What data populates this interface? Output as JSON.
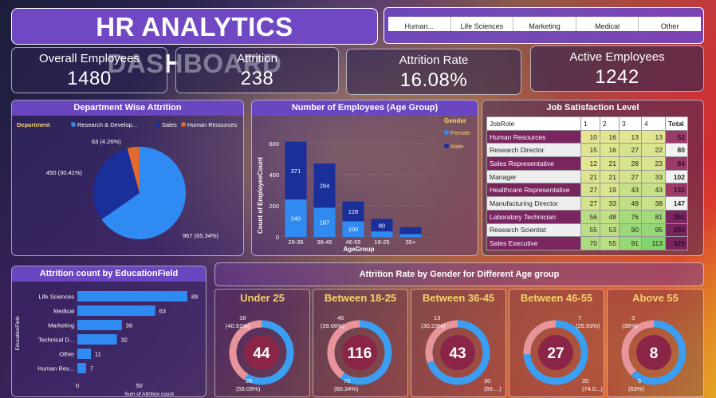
{
  "dashboard": {
    "title": "HR ANALYTICS DASHBOARD"
  },
  "slicer": {
    "items": [
      "Human...",
      "Life Sciences",
      "Marketing",
      "Medical",
      "Other"
    ]
  },
  "kpis": [
    {
      "label": "Overall Employees",
      "value": "1480"
    },
    {
      "label": "Attrition",
      "value": "238"
    },
    {
      "label": "Attrition Rate",
      "value": "16.08%"
    },
    {
      "label": "Active Employees",
      "value": "1242"
    }
  ],
  "colors": {
    "research": "#2f8bf2",
    "sales": "#1a2f9a",
    "hr": "#e36a2f",
    "female": "#2f8bf2",
    "male": "#1a2f9a",
    "donut_a": "#e8949a",
    "donut_b": "#3a9ef2",
    "accent": "#6a46c0"
  },
  "chart_data": [
    {
      "type": "pie",
      "title": "Department Wise Attrition",
      "legend_title": "Department",
      "legend": [
        "Research & Develop...",
        "Sales",
        "Human Resources"
      ],
      "values": [
        967,
        450,
        63
      ],
      "labels": [
        "967 (65.34%)",
        "450 (30.41%)",
        "63 (4.26%)"
      ]
    },
    {
      "type": "bar",
      "title": "Number of Employees (Age Group)",
      "xlabel": "AgeGroup",
      "ylabel": "Count of EmployeeCount",
      "legend_title": "Gender",
      "categories": [
        "26-35",
        "36-45",
        "46-55",
        "18-25",
        "55+"
      ],
      "series": [
        {
          "name": "Female",
          "values": [
            240,
            187,
            100,
            35,
            18
          ]
        },
        {
          "name": "Male",
          "values": [
            371,
            284,
            128,
            80,
            44
          ]
        }
      ],
      "bar_labels": {
        "Female": [
          "240",
          "187",
          "100",
          "",
          ""
        ],
        "Male": [
          "371",
          "284",
          "128",
          "80",
          ""
        ]
      },
      "yticks": [
        "0",
        "200",
        "400",
        "600"
      ],
      "ylim": [
        0,
        650
      ]
    },
    {
      "type": "table",
      "title": "Job Satisfaction Level",
      "columns": [
        "JobRole",
        "1",
        "2",
        "3",
        "4",
        "Total"
      ],
      "rows": [
        [
          "Human Resources",
          "10",
          "16",
          "13",
          "13",
          "52"
        ],
        [
          "Research Director",
          "15",
          "16",
          "27",
          "22",
          "80"
        ],
        [
          "Sales Representative",
          "12",
          "21",
          "28",
          "23",
          "84"
        ],
        [
          "Manager",
          "21",
          "21",
          "27",
          "33",
          "102"
        ],
        [
          "Healthcare Representative",
          "27",
          "19",
          "43",
          "43",
          "132"
        ],
        [
          "Manufacturing Director",
          "27",
          "33",
          "49",
          "38",
          "147"
        ],
        [
          "Laboratory Technician",
          "56",
          "48",
          "76",
          "81",
          "261"
        ],
        [
          "Research Scientist",
          "55",
          "53",
          "90",
          "95",
          "293"
        ],
        [
          "Sales Executive",
          "70",
          "55",
          "91",
          "113",
          "329"
        ]
      ]
    },
    {
      "type": "bar",
      "title": "Attrition count by EducationField",
      "xlabel": "Sum of Attrition count",
      "ylabel": "EducationField",
      "categories": [
        "Life Sciences",
        "Medical",
        "Marketing",
        "Technical D...",
        "Other",
        "Human Res..."
      ],
      "values": [
        89,
        63,
        36,
        32,
        11,
        7
      ],
      "xticks": [
        "0",
        "50"
      ],
      "xlim": [
        0,
        100
      ]
    },
    {
      "type": "pie",
      "title": "Attrition Rate by Gender for Different Age group",
      "groups": [
        {
          "name": "Under 25",
          "total": "44",
          "a": 18,
          "b": 26,
          "a_label": [
            "18",
            "(40.91%)"
          ],
          "b_label": [
            "26",
            "(59.09%)"
          ]
        },
        {
          "name": "Between 18-25",
          "total": "116",
          "a": 46,
          "b": 70,
          "a_label": [
            "46",
            "(39.66%)"
          ],
          "b_label": [
            "70",
            "(60.34%)"
          ]
        },
        {
          "name": "Between 36-45",
          "total": "43",
          "a": 13,
          "b": 30,
          "a_label": [
            "13",
            "(30.23%)"
          ],
          "b_label": [
            "30",
            "(69....)"
          ]
        },
        {
          "name": "Between 46-55",
          "total": "27",
          "a": 7,
          "b": 20,
          "a_label": [
            "7",
            "(25.93%)"
          ],
          "b_label": [
            "20",
            "(74.0...)"
          ]
        },
        {
          "name": "Above 55",
          "total": "8",
          "a": 3,
          "b": 5,
          "a_label": [
            "3",
            "(38%)"
          ],
          "b_label": [
            "5",
            "(63%)"
          ]
        }
      ]
    }
  ]
}
